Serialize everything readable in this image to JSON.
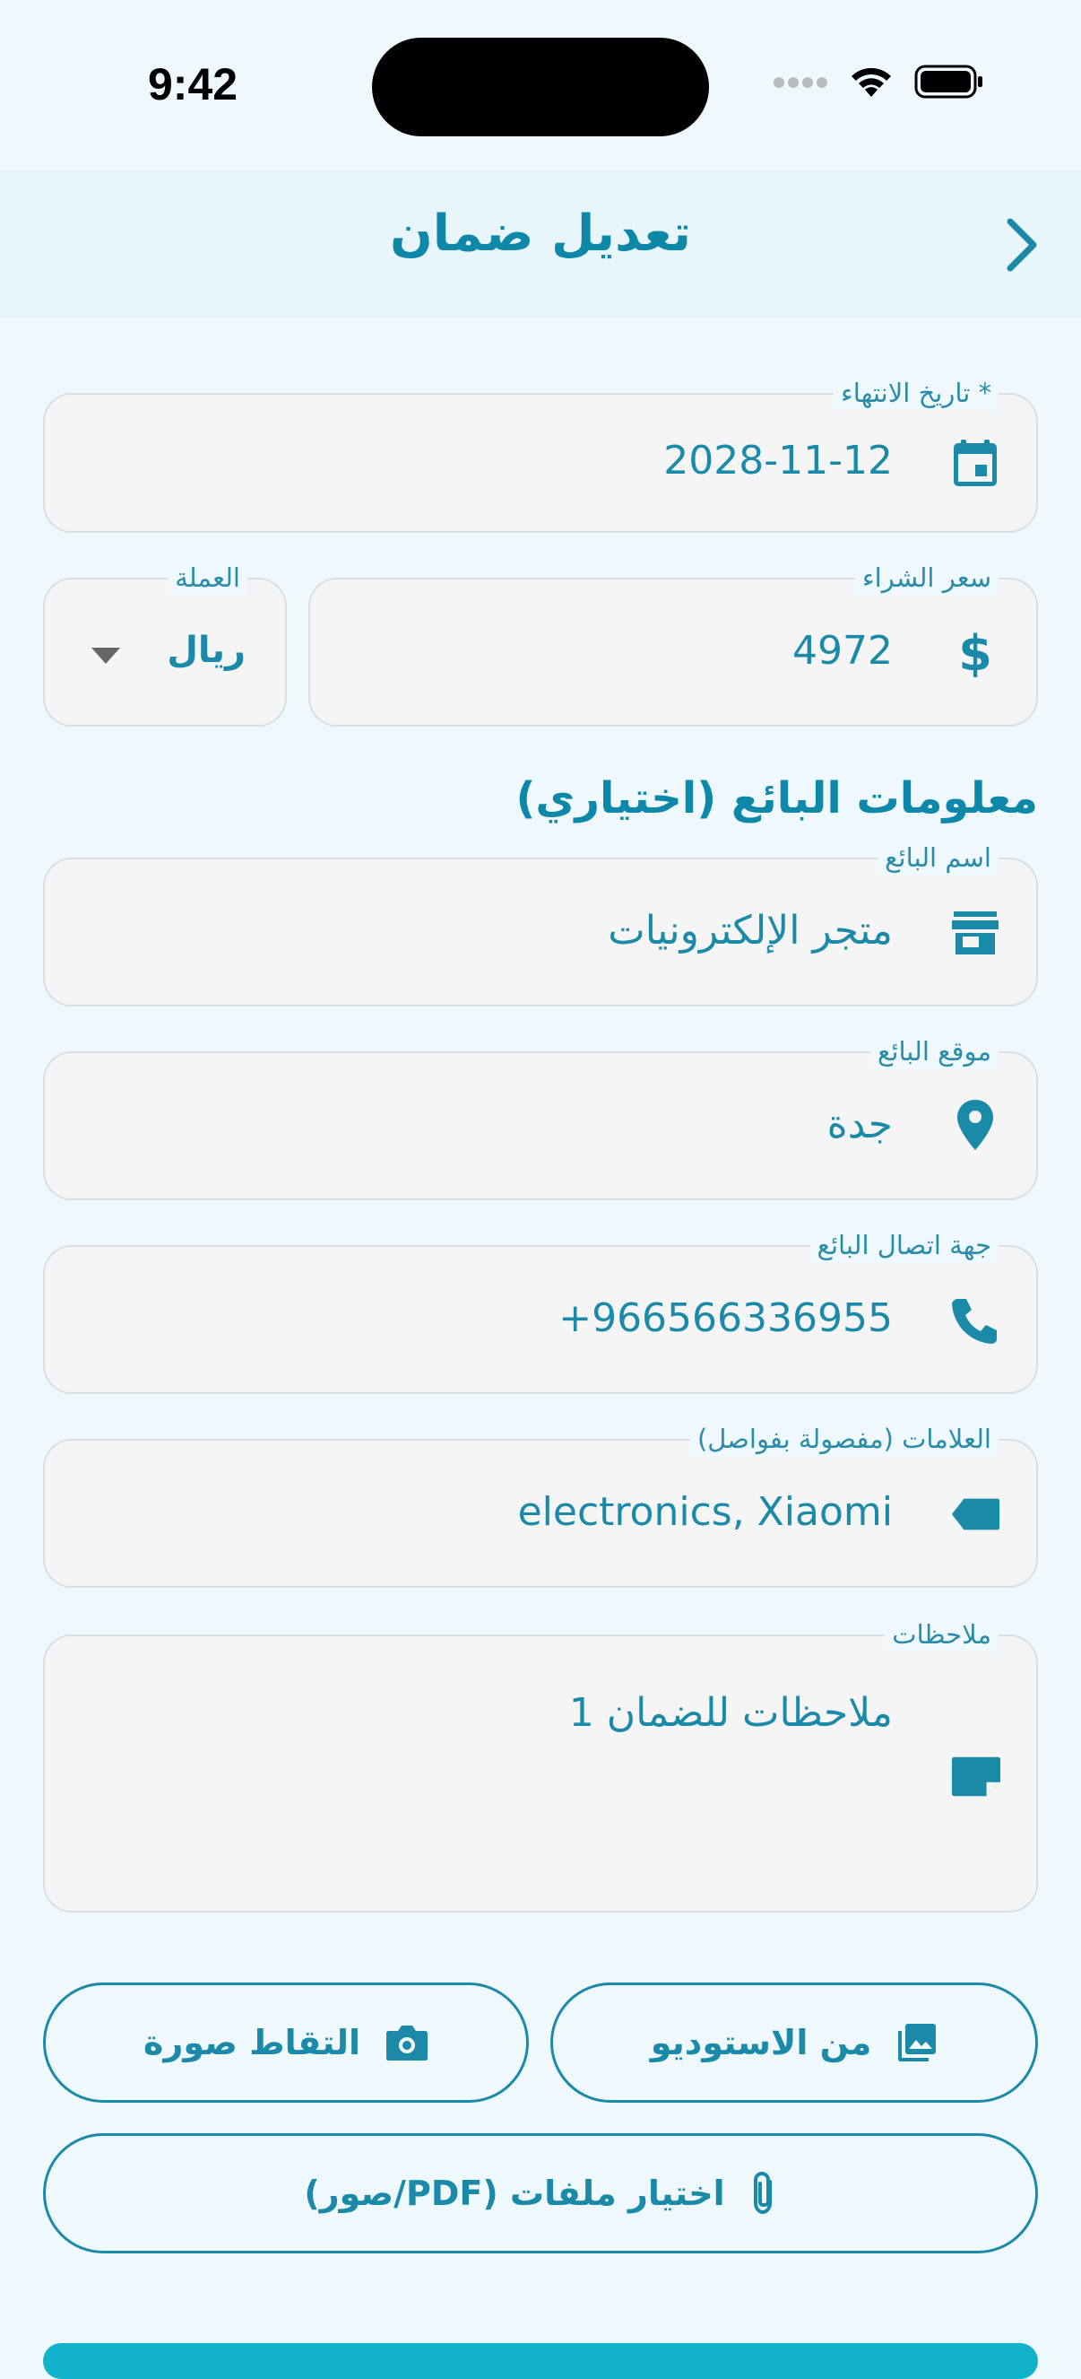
{
  "status": {
    "time": "9:42"
  },
  "header": {
    "title": "تعديل ضمان"
  },
  "form": {
    "expiry": {
      "label": "تاريخ الانتهاء *",
      "value": "2028-11-12"
    },
    "price": {
      "label": "سعر الشراء",
      "value": "4972"
    },
    "currency": {
      "label": "العملة",
      "value": "ريال"
    },
    "seller_section": "معلومات البائع (اختياري)",
    "seller_name": {
      "label": "اسم البائع",
      "value": "متجر الإلكترونيات"
    },
    "seller_location": {
      "label": "موقع البائع",
      "value": "جدة"
    },
    "seller_contact": {
      "label": "جهة اتصال البائع",
      "value": "+966566336955"
    },
    "tags": {
      "label": "العلامات (مفصولة بفواصل)",
      "value": "electronics, Xiaomi"
    },
    "notes": {
      "label": "ملاحظات",
      "value": "ملاحظات للضمان 1"
    }
  },
  "actions": {
    "gallery": "من الاستوديو",
    "camera": "التقاط صورة",
    "files": "اختيار ملفات (PDF/صور)"
  },
  "icons": {
    "back": "chevron-right-icon",
    "expiry": "calendar-icon",
    "price": "dollar-icon",
    "currency": "dropdown-arrow-icon",
    "seller_name": "store-icon",
    "seller_location": "location-pin-icon",
    "seller_contact": "phone-icon",
    "tags": "label-icon",
    "notes": "note-icon",
    "gallery": "image-icon",
    "camera": "camera-icon",
    "files": "paperclip-icon"
  },
  "colors": {
    "accent": "#1a8aa8",
    "background": "#eff8fc",
    "field": "#f5f5f5"
  }
}
